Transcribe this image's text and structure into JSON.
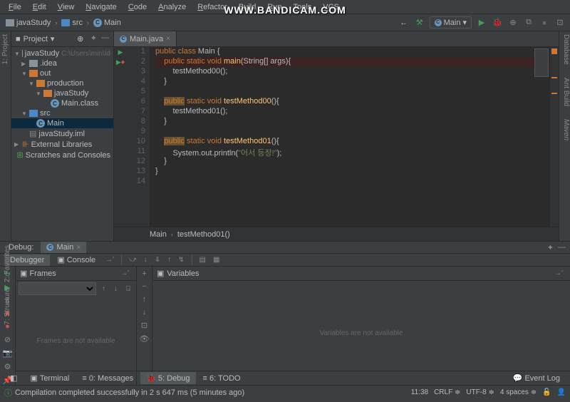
{
  "watermark": "WWW.BANDICAM.COM",
  "menu": [
    "File",
    "Edit",
    "View",
    "Navigate",
    "Code",
    "Analyze",
    "Refactor",
    "Build",
    "Run",
    "Tools",
    "VCS"
  ],
  "nav": {
    "breadcrumbs": [
      {
        "icon": "folder",
        "label": "javaStudy"
      },
      {
        "icon": "folder-blue",
        "label": "src"
      },
      {
        "icon": "class",
        "label": "Main"
      }
    ],
    "run_config": "Main"
  },
  "project": {
    "title": "Project",
    "tree": [
      {
        "level": 0,
        "arrow": "▼",
        "icon": "folder",
        "label": "javaStudy",
        "path": "C:\\Users\\min\\Id"
      },
      {
        "level": 1,
        "arrow": "▶",
        "icon": "folder",
        "label": ".idea"
      },
      {
        "level": 1,
        "arrow": "▼",
        "icon": "folder-orange",
        "label": "out"
      },
      {
        "level": 2,
        "arrow": "▼",
        "icon": "folder-orange",
        "label": "production"
      },
      {
        "level": 3,
        "arrow": "▼",
        "icon": "folder-orange",
        "label": "javaStudy"
      },
      {
        "level": 4,
        "arrow": "",
        "icon": "class",
        "label": "Main.class"
      },
      {
        "level": 1,
        "arrow": "▼",
        "icon": "folder-blue",
        "label": "src"
      },
      {
        "level": 2,
        "arrow": "",
        "icon": "class",
        "label": "Main",
        "selected": true
      },
      {
        "level": 1,
        "arrow": "",
        "icon": "file",
        "label": "javaStudy.iml"
      },
      {
        "level": 0,
        "arrow": "▶",
        "icon": "lib",
        "label": "External Libraries"
      },
      {
        "level": 0,
        "arrow": "",
        "icon": "scratch",
        "label": "Scratches and Consoles"
      }
    ]
  },
  "editor": {
    "tab": "Main.java",
    "breadcrumb": [
      "Main",
      "testMethod01()"
    ],
    "gutter_icons": {
      "1": "▶",
      "2": "▶◆"
    },
    "lines": [
      {
        "n": 1,
        "html": "<span class='kw'>public class</span> Main {"
      },
      {
        "n": 2,
        "html": "    <span class='kw'>public static void</span> <span class='fn'>main</span>(String[] args){",
        "exec": true
      },
      {
        "n": 3,
        "html": "        testMethod00();"
      },
      {
        "n": 4,
        "html": "    }"
      },
      {
        "n": 5,
        "html": ""
      },
      {
        "n": 6,
        "html": "    <span class='kw-hl'>public</span> <span class='kw'>static void</span> <span class='fn'>testMethod00</span>(){"
      },
      {
        "n": 7,
        "html": "        testMethod01();"
      },
      {
        "n": 8,
        "html": "    }"
      },
      {
        "n": 9,
        "html": ""
      },
      {
        "n": 10,
        "html": "    <span class='kw-hl'>public</span> <span class='kw'>static void</span> <span class='fn'>testMethod01</span>(){"
      },
      {
        "n": 11,
        "html": "        System.out.println(<span class='str'>\"어서 등장!\"</span>);"
      },
      {
        "n": 12,
        "html": "    }"
      },
      {
        "n": 13,
        "html": "}"
      },
      {
        "n": 14,
        "html": ""
      }
    ]
  },
  "debug": {
    "label": "Debug:",
    "tab_name": "Main",
    "subtabs": {
      "debugger": "Debugger",
      "console": "Console"
    },
    "frames": {
      "title": "Frames",
      "empty": "Frames are not available"
    },
    "variables": {
      "title": "Variables",
      "empty": "Variables are not available"
    }
  },
  "bottom_tabs": {
    "terminal": "Terminal",
    "messages": "0: Messages",
    "debug": "5: Debug",
    "todo": "6: TODO",
    "eventlog": "Event Log"
  },
  "status": {
    "message": "Compilation completed successfully in 2 s 647 ms (5 minutes ago)",
    "pos": "11:38",
    "line_sep": "CRLF",
    "encoding": "UTF-8",
    "indent": "4 spaces"
  },
  "right_rails": [
    "Database",
    "Ant Build",
    "Maven"
  ],
  "left_rails": {
    "project": "1: Project",
    "favorites": "2: Favorites",
    "structure": "7: Structure"
  }
}
